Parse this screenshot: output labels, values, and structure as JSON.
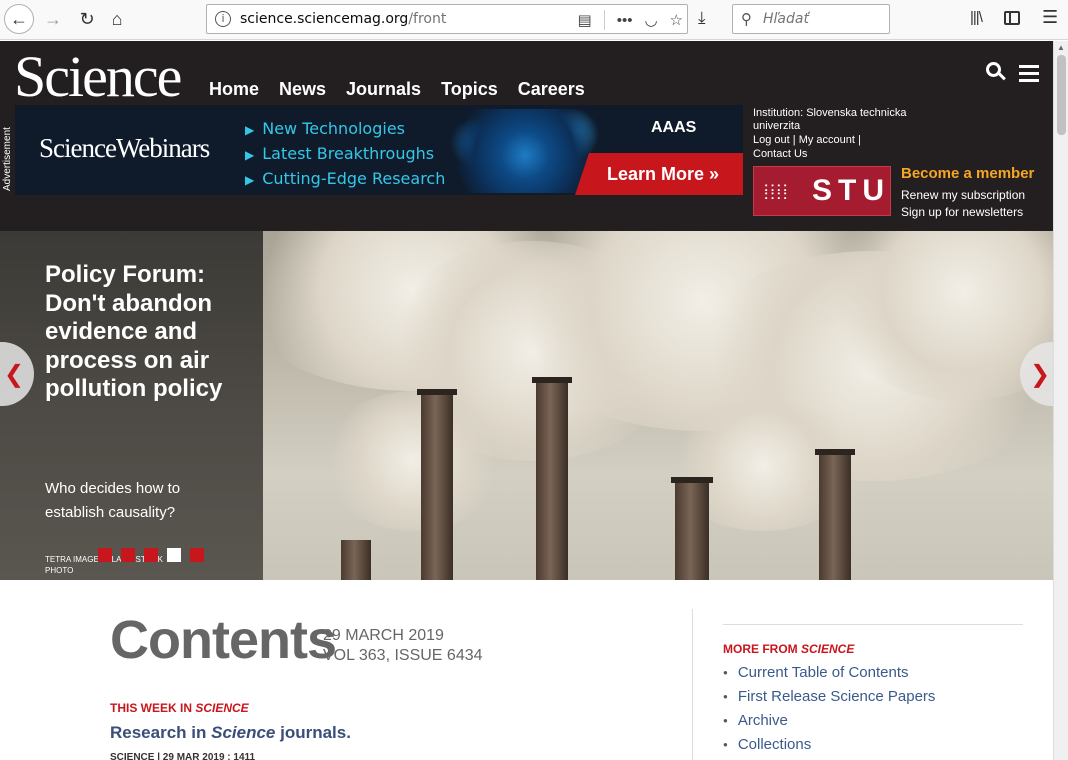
{
  "browser": {
    "url_domain": "science.sciencemag.org",
    "url_path": "/front",
    "search_placeholder": "Hľadať"
  },
  "site": {
    "logo": "Science",
    "nav": [
      "Home",
      "News",
      "Journals",
      "Topics",
      "Careers"
    ]
  },
  "ad": {
    "label": "Advertisement",
    "logo": "ScienceWebinars",
    "items": [
      "New Technologies",
      "Latest Breakthroughs",
      "Cutting-Edge Research"
    ],
    "brand": "AAAS",
    "cta": "Learn More »"
  },
  "institution": {
    "text": "Institution: Slovenska technicka univerzita",
    "logout": "Log out",
    "my_account": "My account",
    "contact": "Contact Us",
    "logo_text": "STU",
    "become_member": "Become a member",
    "renew": "Renew my subscription",
    "signup": "Sign up for newsletters"
  },
  "hero": {
    "title": "Policy Forum: Don't abandon evidence and process on air pollution policy",
    "deck": "Who decides how to establish causality?",
    "credit": "TETRA IMAGES/ALAMY STOCK PHOTO",
    "slides": 5,
    "active_slide": 4,
    "prev": "❮",
    "next": "❯"
  },
  "contents": {
    "heading": "Contents",
    "date": "29 MARCH 2019",
    "volume": "VOL 363, ISSUE 6434",
    "kicker_prefix": "THIS WEEK IN ",
    "kicker_journal": "SCIENCE",
    "article_prefix": "Research in ",
    "article_journal": "Science",
    "article_suffix": " journals.",
    "byline": "SCIENCE | 29 MAR 2019 : 1411"
  },
  "more": {
    "title_prefix": "MORE FROM ",
    "title_journal": "SCIENCE",
    "items": [
      "Current Table of Contents",
      "First Release Science Papers",
      "Archive",
      "Collections"
    ]
  }
}
